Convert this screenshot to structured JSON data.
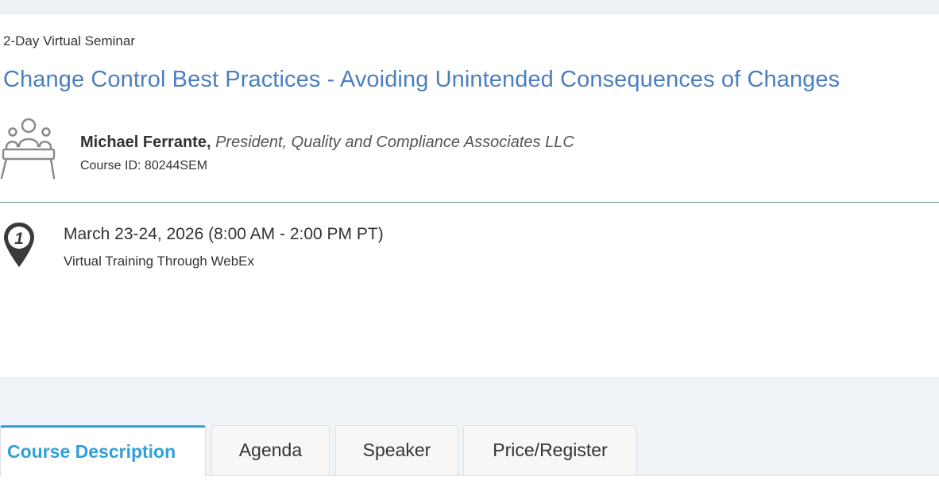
{
  "seminar": {
    "type_label": "2-Day Virtual Seminar",
    "title": "Change Control Best Practices - Avoiding Unintended Consequences of Changes"
  },
  "speaker": {
    "name": "Michael Ferrante,",
    "title": "President, Quality and Compliance Associates LLC",
    "course_id": "Course ID: 80244SEM",
    "icon": "podium-speaker-icon"
  },
  "session": {
    "number": "1",
    "date": "March 23-24, 2026 (8:00 AM - 2:00 PM PT)",
    "location": "Virtual Training Through WebEx",
    "icon": "location-pin-icon"
  },
  "tabs": [
    {
      "label": "Course Description",
      "active": true
    },
    {
      "label": "Agenda",
      "active": false
    },
    {
      "label": "Speaker",
      "active": false
    },
    {
      "label": "Price/Register",
      "active": false
    }
  ],
  "colors": {
    "title_blue": "#4a7fc1",
    "active_tab_blue": "#2fa1da",
    "divider": "#6b8e8c"
  }
}
